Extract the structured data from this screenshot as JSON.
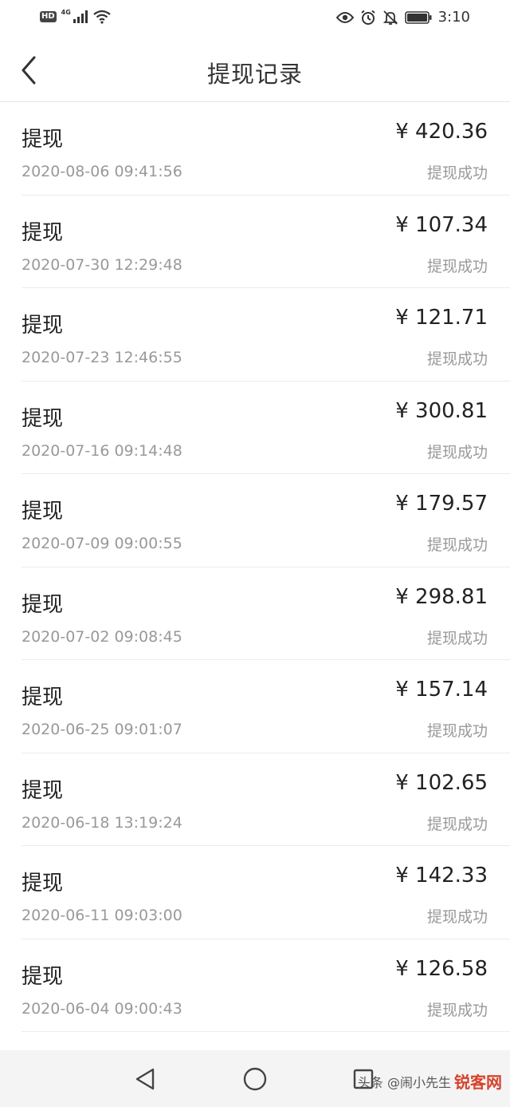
{
  "status_bar": {
    "hd_badge": "HD",
    "network": "4G",
    "time": "3:10",
    "icons": [
      "signal-icon",
      "wifi-icon",
      "eye-icon",
      "alarm-icon",
      "mute-icon",
      "battery-icon"
    ]
  },
  "nav": {
    "title": "提现记录",
    "back_icon": "chevron-left-icon"
  },
  "records": [
    {
      "title": "提现",
      "time": "2020-08-06 09:41:56",
      "amount": "¥ 420.36",
      "status": "提现成功"
    },
    {
      "title": "提现",
      "time": "2020-07-30 12:29:48",
      "amount": "¥ 107.34",
      "status": "提现成功"
    },
    {
      "title": "提现",
      "time": "2020-07-23 12:46:55",
      "amount": "¥ 121.71",
      "status": "提现成功"
    },
    {
      "title": "提现",
      "time": "2020-07-16 09:14:48",
      "amount": "¥ 300.81",
      "status": "提现成功"
    },
    {
      "title": "提现",
      "time": "2020-07-09 09:00:55",
      "amount": "¥ 179.57",
      "status": "提现成功"
    },
    {
      "title": "提现",
      "time": "2020-07-02 09:08:45",
      "amount": "¥ 298.81",
      "status": "提现成功"
    },
    {
      "title": "提现",
      "time": "2020-06-25 09:01:07",
      "amount": "¥ 157.14",
      "status": "提现成功"
    },
    {
      "title": "提现",
      "time": "2020-06-18 13:19:24",
      "amount": "¥ 102.65",
      "status": "提现成功"
    },
    {
      "title": "提现",
      "time": "2020-06-11 09:03:00",
      "amount": "¥ 142.33",
      "status": "提现成功"
    },
    {
      "title": "提现",
      "time": "2020-06-04 09:00:43",
      "amount": "¥ 126.58",
      "status": "提现成功"
    }
  ],
  "system_nav": {
    "back_icon": "triangle-back-icon",
    "home_icon": "circle-home-icon",
    "recents_icon": "square-recents-icon"
  },
  "watermark": {
    "text": "头条 @闹小先生",
    "logo_text": "锐客网"
  }
}
